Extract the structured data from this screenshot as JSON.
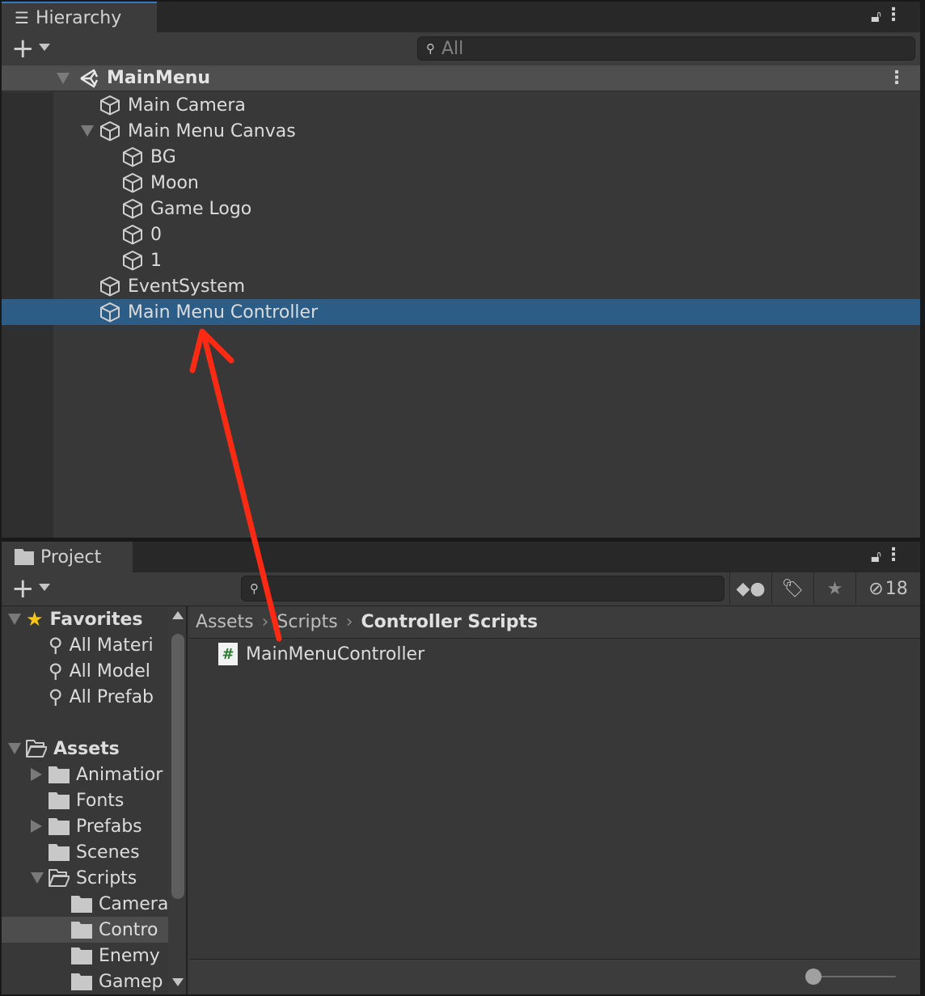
{
  "hierarchy": {
    "tab_label": "Hierarchy",
    "search_placeholder": "All",
    "scene": "MainMenu",
    "items": [
      {
        "label": "Main Camera",
        "level": 1,
        "expanded": null
      },
      {
        "label": "Main Menu Canvas",
        "level": 1,
        "expanded": true
      },
      {
        "label": "BG",
        "level": 2,
        "expanded": null
      },
      {
        "label": "Moon",
        "level": 2,
        "expanded": null
      },
      {
        "label": "Game Logo",
        "level": 2,
        "expanded": null
      },
      {
        "label": "0",
        "level": 2,
        "expanded": null
      },
      {
        "label": "1",
        "level": 2,
        "expanded": null
      },
      {
        "label": "EventSystem",
        "level": 1,
        "expanded": null
      },
      {
        "label": "Main Menu Controller",
        "level": 1,
        "expanded": null,
        "selected": true
      }
    ]
  },
  "project": {
    "tab_label": "Project",
    "search_value": "",
    "hidden_count": "18",
    "tree": [
      {
        "label": "Favorites",
        "type": "star",
        "level": 0,
        "expanded": true,
        "bold": true
      },
      {
        "label": "All Materi",
        "type": "search",
        "level": 1
      },
      {
        "label": "All Model",
        "type": "search",
        "level": 1
      },
      {
        "label": "All Prefab",
        "type": "search",
        "level": 1
      },
      {
        "label": "",
        "type": "gap",
        "level": 0
      },
      {
        "label": "Assets",
        "type": "folder-open",
        "level": 0,
        "expanded": true,
        "bold": true
      },
      {
        "label": "Animatior",
        "type": "folder",
        "level": 1,
        "expanded": false
      },
      {
        "label": "Fonts",
        "type": "folder",
        "level": 1
      },
      {
        "label": "Prefabs",
        "type": "folder",
        "level": 1,
        "expanded": false
      },
      {
        "label": "Scenes",
        "type": "folder",
        "level": 1
      },
      {
        "label": "Scripts",
        "type": "folder-open",
        "level": 1,
        "expanded": true
      },
      {
        "label": "Camera",
        "type": "folder",
        "level": 2
      },
      {
        "label": "Contro",
        "type": "folder",
        "level": 2,
        "selected": true
      },
      {
        "label": "Enemy",
        "type": "folder",
        "level": 2
      },
      {
        "label": "Gamep",
        "type": "folder",
        "level": 2
      }
    ],
    "breadcrumb": [
      "Assets",
      "Scripts",
      "Controller Scripts"
    ],
    "files": [
      {
        "label": "MainMenuController",
        "icon": "csharp-script-icon"
      }
    ]
  },
  "colors": {
    "selection": "#2c5d87",
    "annotation_arrow": "#ff2a14",
    "script_hash": "#2e7d32"
  }
}
